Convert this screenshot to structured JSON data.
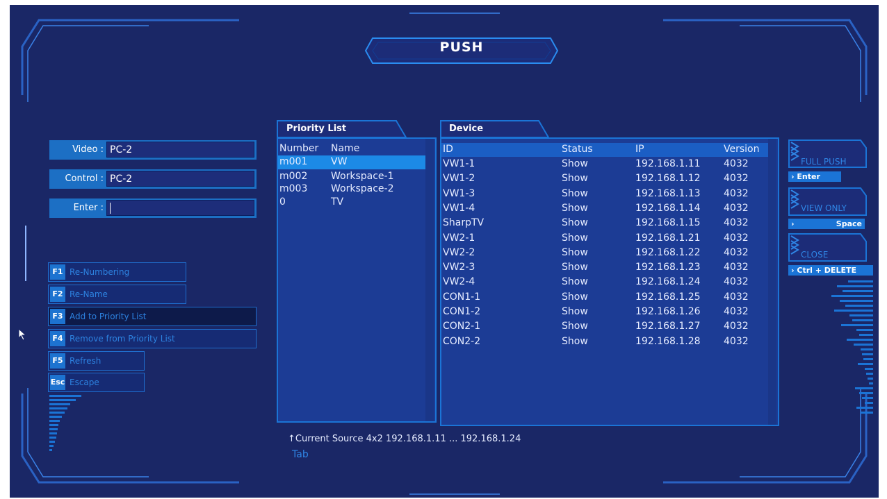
{
  "title": "PUSH",
  "fields": [
    {
      "label": "Video :",
      "value": "PC-2"
    },
    {
      "label": "Control :",
      "value": "PC-2"
    },
    {
      "label": "Enter :",
      "value": ""
    }
  ],
  "fkeys": [
    {
      "key": "F1",
      "label": "Re-Numbering"
    },
    {
      "key": "F2",
      "label": "Re-Name"
    },
    {
      "key": "F3",
      "label": "Add to Priority List"
    },
    {
      "key": "F4",
      "label": "Remove from Priority List"
    },
    {
      "key": "F5",
      "label": "Refresh"
    },
    {
      "key": "Esc",
      "label": "Escape"
    }
  ],
  "priority_list": {
    "title": "Priority List",
    "columns": [
      "Number",
      "Name"
    ],
    "rows": [
      {
        "number": "m001",
        "name": "VW",
        "selected": true
      },
      {
        "number": "m002",
        "name": "Workspace-1"
      },
      {
        "number": "m003",
        "name": "Workspace-2"
      },
      {
        "number": "0",
        "name": "TV"
      }
    ]
  },
  "device_list": {
    "title": "Device",
    "columns": [
      "ID",
      "Status",
      "IP",
      "Version"
    ],
    "rows": [
      {
        "id": "VW1-1",
        "status": "Show",
        "ip": "192.168.1.11",
        "version": "4032"
      },
      {
        "id": "VW1-2",
        "status": "Show",
        "ip": "192.168.1.12",
        "version": "4032"
      },
      {
        "id": "VW1-3",
        "status": "Show",
        "ip": "192.168.1.13",
        "version": "4032"
      },
      {
        "id": "VW1-4",
        "status": "Show",
        "ip": "192.168.1.14",
        "version": "4032"
      },
      {
        "id": "SharpTV",
        "status": "Show",
        "ip": "192.168.1.15",
        "version": "4032"
      },
      {
        "id": "VW2-1",
        "status": "Show",
        "ip": "192.168.1.21",
        "version": "4032"
      },
      {
        "id": "VW2-2",
        "status": "Show",
        "ip": "192.168.1.22",
        "version": "4032"
      },
      {
        "id": "VW2-3",
        "status": "Show",
        "ip": "192.168.1.23",
        "version": "4032"
      },
      {
        "id": "VW2-4",
        "status": "Show",
        "ip": "192.168.1.24",
        "version": "4032"
      },
      {
        "id": "CON1-1",
        "status": "Show",
        "ip": "192.168.1.25",
        "version": "4032"
      },
      {
        "id": "CON1-2",
        "status": "Show",
        "ip": "192.168.1.26",
        "version": "4032"
      },
      {
        "id": "CON2-1",
        "status": "Show",
        "ip": "192.168.1.27",
        "version": "4032"
      },
      {
        "id": "CON2-2",
        "status": "Show",
        "ip": "192.168.1.28",
        "version": "4032"
      }
    ]
  },
  "actions": [
    {
      "label": "FULL PUSH",
      "shortcut": "Enter"
    },
    {
      "label": "VIEW ONLY",
      "shortcut": "Space"
    },
    {
      "label": "CLOSE",
      "shortcut": "Ctrl + DELETE"
    }
  ],
  "status_line": "↑Current Source  4x2  192.168.1.11  ...  192.168.1.24",
  "tab_hint": "Tab",
  "colors": {
    "background": "#1a2766",
    "accent": "#1b74d6",
    "selection": "#1c8ae6",
    "panel": "#1c3c95",
    "muted_text": "#2f86e6"
  }
}
